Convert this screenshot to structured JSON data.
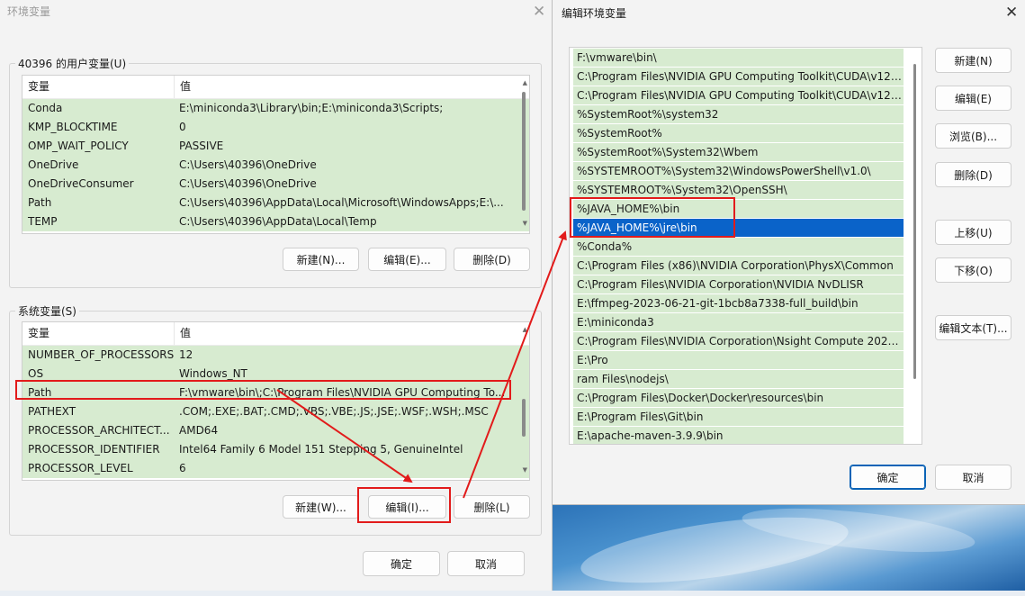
{
  "env_dialog": {
    "title": "环境变量",
    "user_group": {
      "legend": "40396 的用户变量(U)",
      "col_name": "变量",
      "col_value": "值",
      "rows": [
        {
          "name": "Conda",
          "value": "E:\\miniconda3\\Library\\bin;E:\\miniconda3\\Scripts;"
        },
        {
          "name": "KMP_BLOCKTIME",
          "value": "0"
        },
        {
          "name": "OMP_WAIT_POLICY",
          "value": "PASSIVE"
        },
        {
          "name": "OneDrive",
          "value": "C:\\Users\\40396\\OneDrive"
        },
        {
          "name": "OneDriveConsumer",
          "value": "C:\\Users\\40396\\OneDrive"
        },
        {
          "name": "Path",
          "value": "C:\\Users\\40396\\AppData\\Local\\Microsoft\\WindowsApps;E:\\..."
        },
        {
          "name": "TEMP",
          "value": "C:\\Users\\40396\\AppData\\Local\\Temp"
        }
      ],
      "buttons": {
        "new": "新建(N)...",
        "edit": "编辑(E)...",
        "delete": "删除(D)"
      }
    },
    "system_group": {
      "legend": "系统变量(S)",
      "col_name": "变量",
      "col_value": "值",
      "rows": [
        {
          "name": "NUMBER_OF_PROCESSORS",
          "value": "12"
        },
        {
          "name": "OS",
          "value": "Windows_NT"
        },
        {
          "name": "Path",
          "value": "F:\\vmware\\bin\\;C:\\Program Files\\NVIDIA GPU Computing To..."
        },
        {
          "name": "PATHEXT",
          "value": ".COM;.EXE;.BAT;.CMD;.VBS;.VBE;.JS;.JSE;.WSF;.WSH;.MSC"
        },
        {
          "name": "PROCESSOR_ARCHITECT...",
          "value": "AMD64"
        },
        {
          "name": "PROCESSOR_IDENTIFIER",
          "value": "Intel64 Family 6 Model 151 Stepping 5, GenuineIntel"
        },
        {
          "name": "PROCESSOR_LEVEL",
          "value": "6"
        }
      ],
      "buttons": {
        "new": "新建(W)...",
        "edit": "编辑(I)...",
        "delete": "删除(L)"
      }
    },
    "ok": "确定",
    "cancel": "取消"
  },
  "edit_dialog": {
    "title": "编辑环境变量",
    "paths": [
      "F:\\vmware\\bin\\",
      "C:\\Program Files\\NVIDIA GPU Computing Toolkit\\CUDA\\v12....",
      "C:\\Program Files\\NVIDIA GPU Computing Toolkit\\CUDA\\v12....",
      "%SystemRoot%\\system32",
      "%SystemRoot%",
      "%SystemRoot%\\System32\\Wbem",
      "%SYSTEMROOT%\\System32\\WindowsPowerShell\\v1.0\\",
      "%SYSTEMROOT%\\System32\\OpenSSH\\",
      "%JAVA_HOME%\\bin",
      "%JAVA_HOME%\\jre\\bin",
      "%Conda%",
      "C:\\Program Files (x86)\\NVIDIA Corporation\\PhysX\\Common",
      "C:\\Program Files\\NVIDIA Corporation\\NVIDIA NvDLISR",
      "E:\\ffmpeg-2023-06-21-git-1bcb8a7338-full_build\\bin",
      "E:\\miniconda3",
      "C:\\Program Files\\NVIDIA Corporation\\Nsight Compute 2023....",
      "E:\\Pro",
      "ram Files\\nodejs\\",
      "C:\\Program Files\\Docker\\Docker\\resources\\bin",
      "E:\\Program Files\\Git\\bin",
      "E:\\apache-maven-3.9.9\\bin"
    ],
    "selected_index": 9,
    "buttons": {
      "new": "新建(N)",
      "edit": "编辑(E)",
      "browse": "浏览(B)...",
      "delete": "删除(D)",
      "move_up": "上移(U)",
      "move_down": "下移(O)",
      "edit_text": "编辑文本(T)..."
    },
    "ok": "确定",
    "cancel": "取消"
  },
  "colors": {
    "highlight": "#e21b1b",
    "selection": "#0a63c9",
    "row_green": "#d7ebd0"
  }
}
